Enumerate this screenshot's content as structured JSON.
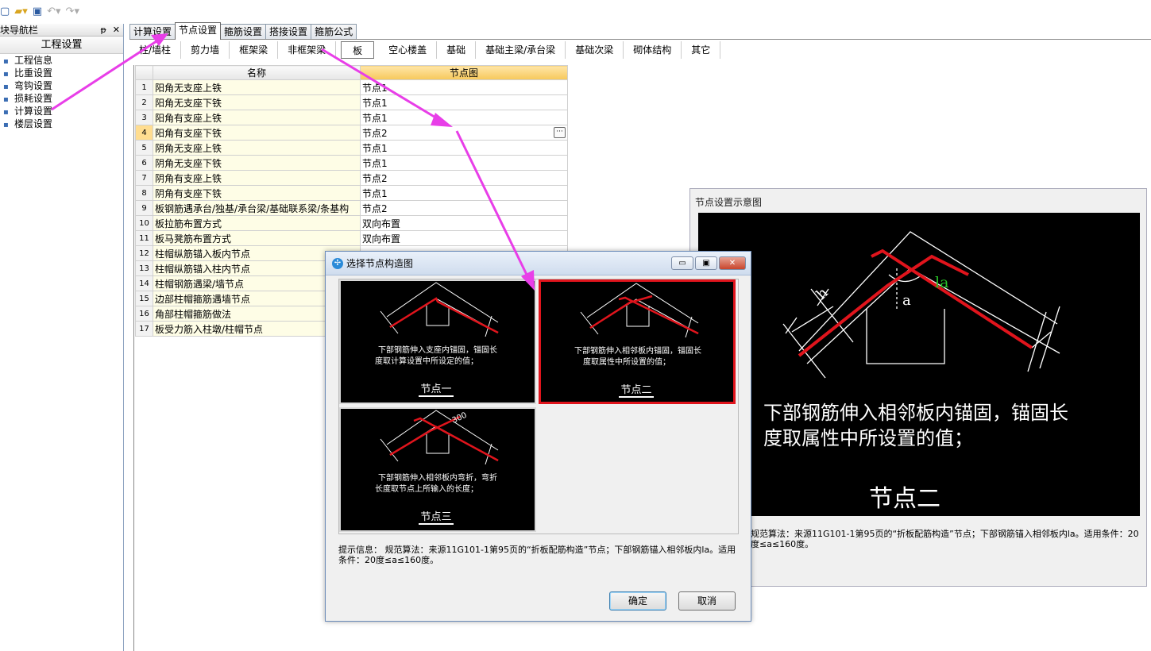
{
  "toolbar": {
    "icons": [
      "new-file-icon",
      "open-folder-icon",
      "save-icon",
      "undo-icon",
      "redo-icon"
    ]
  },
  "nav": {
    "header": "模块导航栏",
    "pin": "ᵽ",
    "close": "✕",
    "title": "工程设置",
    "items": [
      "工程信息",
      "比重设置",
      "弯钩设置",
      "损耗设置",
      "计算设置",
      "楼层设置"
    ]
  },
  "tabs": [
    "计算设置",
    "节点设置",
    "箍筋设置",
    "搭接设置",
    "箍筋公式"
  ],
  "active_tab": 1,
  "subtabs": [
    "柱/墙柱",
    "剪力墙",
    "框架梁",
    "非框架梁",
    "板",
    "空心楼盖",
    "基础",
    "基础主梁/承台梁",
    "基础次梁",
    "砌体结构",
    "其它"
  ],
  "active_subtab": 4,
  "grid": {
    "col_name": "名称",
    "col_node": "节点图",
    "rows": [
      {
        "no": "1",
        "name": "阳角无支座上铁",
        "node": "节点1"
      },
      {
        "no": "2",
        "name": "阳角无支座下铁",
        "node": "节点1"
      },
      {
        "no": "3",
        "name": "阳角有支座上铁",
        "node": "节点1"
      },
      {
        "no": "4",
        "name": "阳角有支座下铁",
        "node": "节点2"
      },
      {
        "no": "5",
        "name": "阴角无支座上铁",
        "node": "节点1"
      },
      {
        "no": "6",
        "name": "阴角无支座下铁",
        "node": "节点1"
      },
      {
        "no": "7",
        "name": "阴角有支座上铁",
        "node": "节点2"
      },
      {
        "no": "8",
        "name": "阴角有支座下铁",
        "node": "节点1"
      },
      {
        "no": "9",
        "name": "板钢筋遇承台/独基/承台梁/基础联系梁/条基构",
        "node": "节点2"
      },
      {
        "no": "10",
        "name": "板拉筋布置方式",
        "node": "双向布置"
      },
      {
        "no": "11",
        "name": "板马凳筋布置方式",
        "node": "双向布置"
      },
      {
        "no": "12",
        "name": "柱帽纵筋锚入板内节点",
        "node": ""
      },
      {
        "no": "13",
        "name": "柱帽纵筋锚入柱内节点",
        "node": ""
      },
      {
        "no": "14",
        "name": "柱帽钢筋遇梁/墙节点",
        "node": ""
      },
      {
        "no": "15",
        "name": "边部柱帽箍筋遇墙节点",
        "node": ""
      },
      {
        "no": "16",
        "name": "角部柱帽箍筋做法",
        "node": ""
      },
      {
        "no": "17",
        "name": "板受力筋入柱墩/柱帽节点",
        "node": ""
      }
    ],
    "selected_row": 3,
    "ellipsis": "···"
  },
  "preview": {
    "title": "节点设置示意图",
    "line1": "下部钢筋伸入相邻板内锚固，锚固长",
    "line2": "度取属性中所设置的值；",
    "caption": "节点二",
    "label_h": "h",
    "label_a": "a",
    "label_la": "la",
    "info": "规范算法：来源11G101-1第95页的“折板配筋构造”节点；下部钢筋锚入相邻板内la。适用条件：20度≤a≤160度。"
  },
  "dialog": {
    "title": "选择节点构造图",
    "min": "▭",
    "max": "▣",
    "close": "✕",
    "options": [
      {
        "line1": "下部钢筋伸入支座内锚固，锚固长",
        "line2": "度取计算设置中所设定的值；",
        "caption": "节点一"
      },
      {
        "line1": "下部钢筋伸入相邻板内锚固，锚固长",
        "line2": "度取属性中所设置的值；",
        "caption": "节点二"
      },
      {
        "line1": "下部钢筋伸入相邻板内弯折，弯折",
        "line2": "长度取节点上所输入的长度；",
        "caption": "节点三"
      }
    ],
    "selected_option": 1,
    "option3_dim": "300",
    "info_label": "提示信息：",
    "info": "规范算法：来源11G101-1第95页的“折板配筋构造”节点；下部钢筋锚入相邻板内la。适用条件：20度≤a≤160度。",
    "ok": "确定",
    "cancel": "取消"
  },
  "colors": {
    "annotation_arrow": "#e83ee8",
    "rebar": "#e0141c",
    "selected_border": "#e0141c",
    "header_highlight": "#f6c85a"
  }
}
